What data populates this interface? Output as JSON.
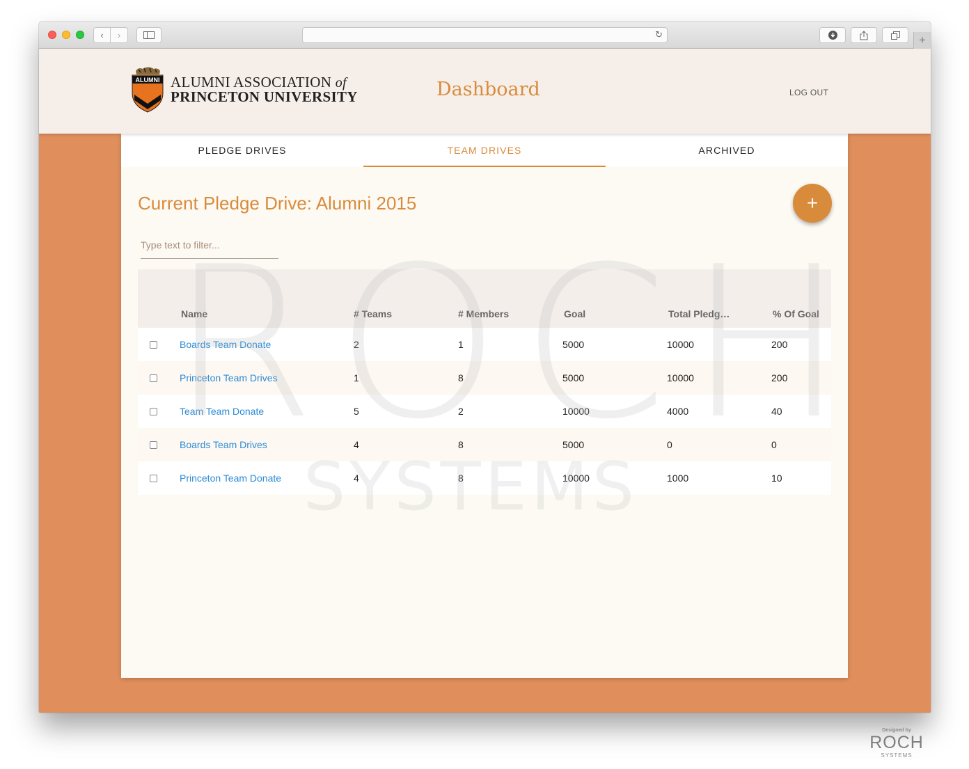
{
  "browser": {
    "url": ""
  },
  "header": {
    "logo_badge": "ALUMNI",
    "logo_line1": "ALUMNI ASSOCIATION",
    "logo_of": "of",
    "logo_line2": "PRINCETON UNIVERSITY",
    "title": "Dashboard",
    "logout": "LOG OUT"
  },
  "tabs": [
    {
      "label": "PLEDGE DRIVES",
      "active": false
    },
    {
      "label": "TEAM DRIVES",
      "active": true
    },
    {
      "label": "ARCHIVED",
      "active": false
    }
  ],
  "main": {
    "title": "Current Pledge Drive: Alumni 2015",
    "add_label": "+",
    "filter_placeholder": "Type text to filter...",
    "filter_value": ""
  },
  "table": {
    "columns": [
      "Name",
      "# Teams",
      "# Members",
      "Goal",
      "Total Pledg…",
      "% Of Goal"
    ],
    "rows": [
      {
        "name": "Boards Team Donate",
        "teams": "2",
        "members": "1",
        "goal": "5000",
        "total": "10000",
        "pct": "200"
      },
      {
        "name": "Princeton Team Drives",
        "teams": "1",
        "members": "8",
        "goal": "5000",
        "total": "10000",
        "pct": "200"
      },
      {
        "name": "Team Team Donate",
        "teams": "5",
        "members": "2",
        "goal": "10000",
        "total": "4000",
        "pct": "40"
      },
      {
        "name": "Boards Team Drives",
        "teams": "4",
        "members": "8",
        "goal": "5000",
        "total": "0",
        "pct": "0"
      },
      {
        "name": "Princeton Team Donate",
        "teams": "4",
        "members": "8",
        "goal": "10000",
        "total": "1000",
        "pct": "10"
      }
    ]
  },
  "watermark": {
    "line1": "ROCH",
    "line2": "SYSTEMS"
  },
  "footer": {
    "designed_by": "Designed by",
    "brand": "ROCH",
    "brand_sub": "SYSTEMS"
  },
  "colors": {
    "accent": "#d98b3c",
    "background": "#e08f5c",
    "link": "#2b8bd6",
    "header_bg": "#f6efe9"
  }
}
